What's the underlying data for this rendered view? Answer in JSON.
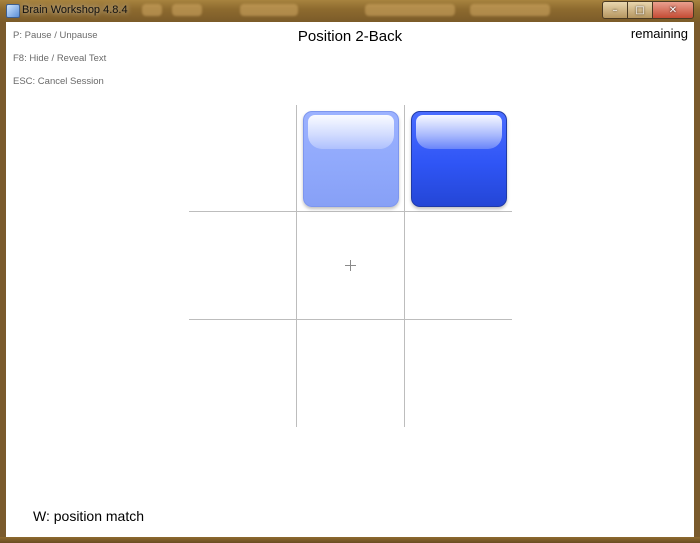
{
  "window": {
    "title": "Brain Workshop 4.8.4",
    "controls": {
      "minimize": "–",
      "maximize": "□",
      "close": "✕"
    }
  },
  "help": {
    "pause": "P: Pause / Unpause",
    "hide_text": "F8: Hide / Reveal Text",
    "cancel": "ESC: Cancel Session"
  },
  "header": {
    "title": "Position 2-Back",
    "remaining": "remaining"
  },
  "grid": {
    "rows": 3,
    "cols": 3,
    "line_color": "#bdbdbd",
    "highlighted_cells": [
      {
        "row": 0,
        "col": 1,
        "style": "light-blue"
      },
      {
        "row": 0,
        "col": 2,
        "style": "blue"
      }
    ],
    "center_marker": "crosshair-icon"
  },
  "footer": {
    "key_hint": "W: position match"
  },
  "colors": {
    "light_square": "#8fa8fb",
    "dark_square": "#2f55f5",
    "frame": "#8e6b2f"
  }
}
